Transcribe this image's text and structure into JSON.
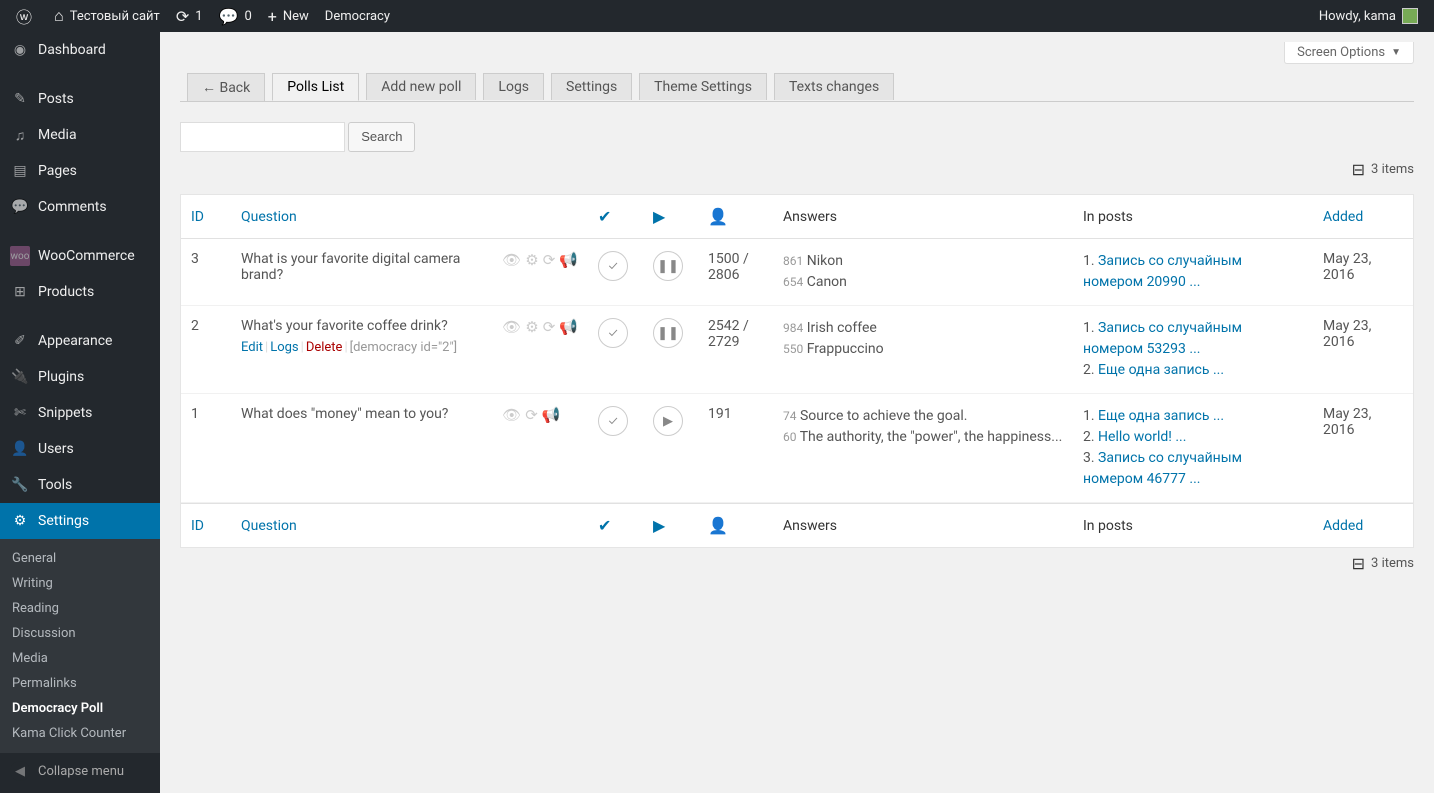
{
  "adminbar": {
    "site_title": "Тестовый сайт",
    "updates": "1",
    "comments": "0",
    "new": "New",
    "democracy": "Democracy",
    "howdy": "Howdy, kama"
  },
  "sidebar": {
    "items": [
      {
        "label": "Dashboard"
      },
      {
        "label": "Posts"
      },
      {
        "label": "Media"
      },
      {
        "label": "Pages"
      },
      {
        "label": "Comments"
      },
      {
        "label": "WooCommerce"
      },
      {
        "label": "Products"
      },
      {
        "label": "Appearance"
      },
      {
        "label": "Plugins"
      },
      {
        "label": "Snippets"
      },
      {
        "label": "Users"
      },
      {
        "label": "Tools"
      },
      {
        "label": "Settings"
      }
    ],
    "submenu": [
      {
        "label": "General"
      },
      {
        "label": "Writing"
      },
      {
        "label": "Reading"
      },
      {
        "label": "Discussion"
      },
      {
        "label": "Media"
      },
      {
        "label": "Permalinks"
      },
      {
        "label": "Democracy Poll"
      },
      {
        "label": "Kama Click Counter"
      }
    ],
    "collapse": "Collapse menu"
  },
  "screen_options": "Screen Options",
  "tabs": {
    "back": "← Back",
    "polls_list": "Polls List",
    "add_new": "Add new poll",
    "logs": "Logs",
    "settings": "Settings",
    "theme": "Theme Settings",
    "texts": "Texts changes"
  },
  "search_label": "Search",
  "items_count": "3 items",
  "columns": {
    "id": "ID",
    "question": "Question",
    "answers": "Answers",
    "in_posts": "In posts",
    "added": "Added"
  },
  "rows": [
    {
      "id": "3",
      "question": "What is your favorite digital camera brand?",
      "play_state": "pause",
      "votes_top": "1500 /",
      "votes_bottom": "2806",
      "answers": [
        {
          "count": "861",
          "text": "Nikon"
        },
        {
          "count": "654",
          "text": "Canon"
        }
      ],
      "posts": [
        {
          "n": "1.",
          "text": "Запись со случайным номером 20990 ..."
        }
      ],
      "date": "May 23, 2016"
    },
    {
      "id": "2",
      "question": "What's your favorite coffee drink?",
      "row_actions": {
        "edit": "Edit",
        "logs": "Logs",
        "delete": "Delete",
        "shortcode": "[democracy id=\"2\"]"
      },
      "play_state": "pause",
      "votes_top": "2542 /",
      "votes_bottom": "2729",
      "answers": [
        {
          "count": "984",
          "text": "Irish coffee"
        },
        {
          "count": "550",
          "text": "Frappuccino"
        }
      ],
      "posts": [
        {
          "n": "1.",
          "text": "Запись со случайным номером 53293 ..."
        },
        {
          "n": "2.",
          "text": "Еще одна запись ..."
        }
      ],
      "date": "May 23, 2016"
    },
    {
      "id": "1",
      "question": "What does \"money\" mean to you?",
      "play_state": "play",
      "votes_top": "191",
      "votes_bottom": "",
      "answers": [
        {
          "count": "74",
          "text": "Source to achieve the goal."
        },
        {
          "count": "60",
          "text": "The authority, the \"power\", the happiness..."
        }
      ],
      "posts": [
        {
          "n": "1.",
          "text": "Еще одна запись ..."
        },
        {
          "n": "2.",
          "text": "Hello world! ..."
        },
        {
          "n": "3.",
          "text": "Запись со случайным номером 46777 ..."
        }
      ],
      "date": "May 23, 2016"
    }
  ]
}
